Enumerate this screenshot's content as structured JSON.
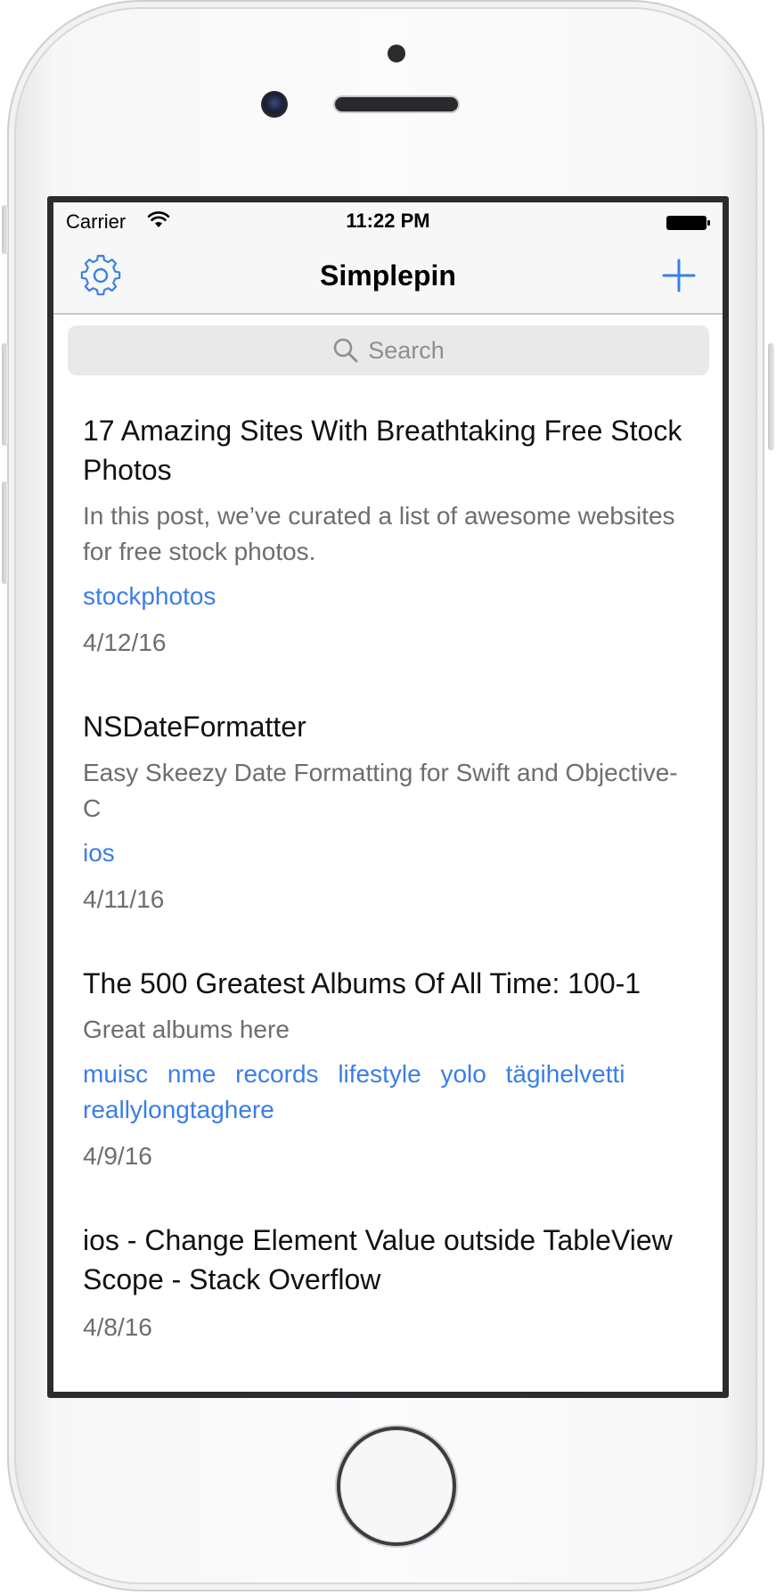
{
  "status_bar": {
    "carrier": "Carrier",
    "time": "11:22 PM"
  },
  "nav": {
    "title": "Simplepin",
    "left_icon": "gear-icon",
    "right_icon": "plus-icon"
  },
  "search": {
    "placeholder": "Search"
  },
  "accent_color": "#3b7ee6",
  "posts": [
    {
      "title": "17 Amazing Sites With Breathtaking Free Stock Photos",
      "description": "In this post, we’ve curated a list of awesome websites for free stock photos.",
      "tags": [
        "stockphotos"
      ],
      "date": "4/12/16"
    },
    {
      "title": "NSDateFormatter",
      "description": "Easy Skeezy Date Formatting for Swift and Objective-C",
      "tags": [
        "ios"
      ],
      "date": "4/11/16"
    },
    {
      "title": "The 500 Greatest Albums Of All Time: 100-1",
      "description": "Great albums here",
      "tags": [
        "muisc",
        "nme",
        "records",
        "lifestyle",
        "yolo",
        "tägihelvetti",
        "reallylongtaghere"
      ],
      "date": "4/9/16"
    },
    {
      "title": "ios - Change Element Value outside TableView Scope - Stack Overflow",
      "description": "",
      "tags": [],
      "date": "4/8/16"
    }
  ]
}
